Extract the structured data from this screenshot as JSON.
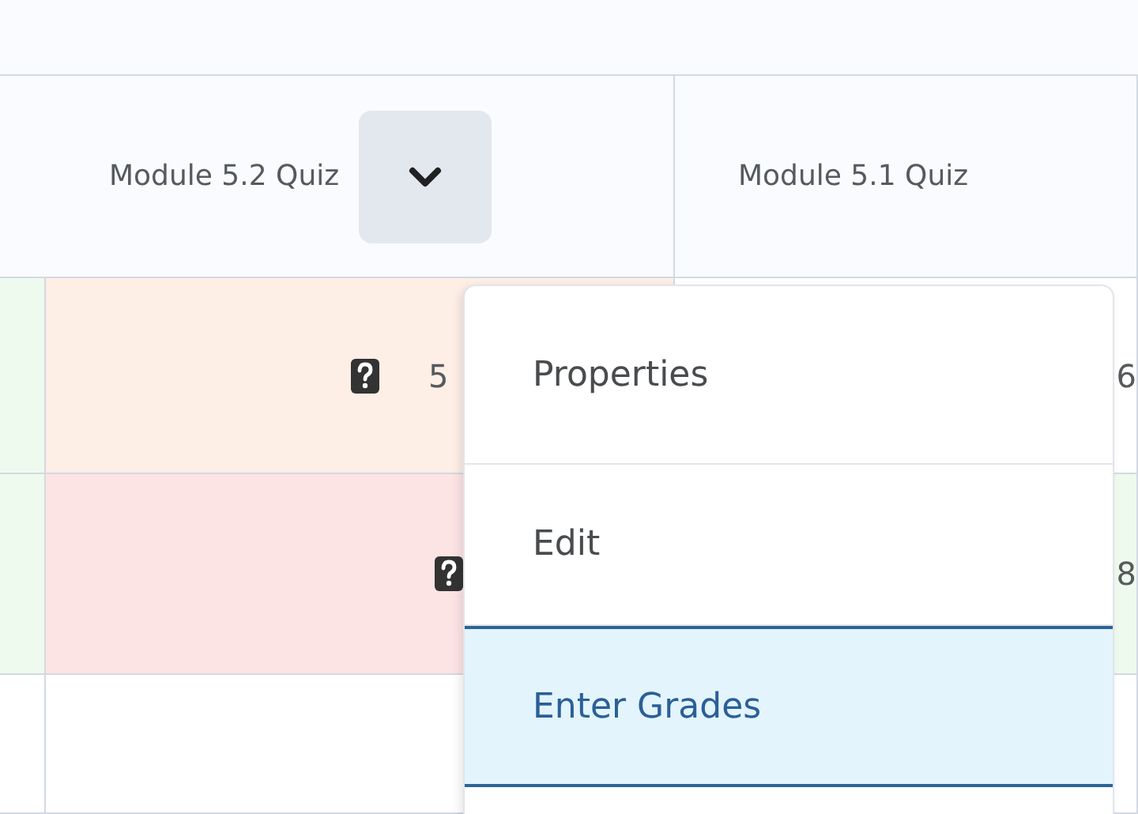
{
  "columns": [
    {
      "label": "Module 5.2 Quiz",
      "menu_button": true
    },
    {
      "label": "Module 5.1 Quiz",
      "menu_button": false
    }
  ],
  "rows": [
    {
      "cells": [
        {
          "value": "5",
          "color": "#fdeee6",
          "flagged": true
        },
        {
          "value": "6",
          "color": "#ffffff"
        }
      ]
    },
    {
      "cells": [
        {
          "color": "#fde4e4",
          "flagged": true
        },
        {
          "value": "8",
          "color": "#eefaee"
        }
      ]
    }
  ],
  "menu": {
    "items": [
      {
        "label": "Properties",
        "selected": false
      },
      {
        "label": "Edit",
        "selected": false
      },
      {
        "label": "Enter Grades",
        "selected": true
      }
    ]
  }
}
